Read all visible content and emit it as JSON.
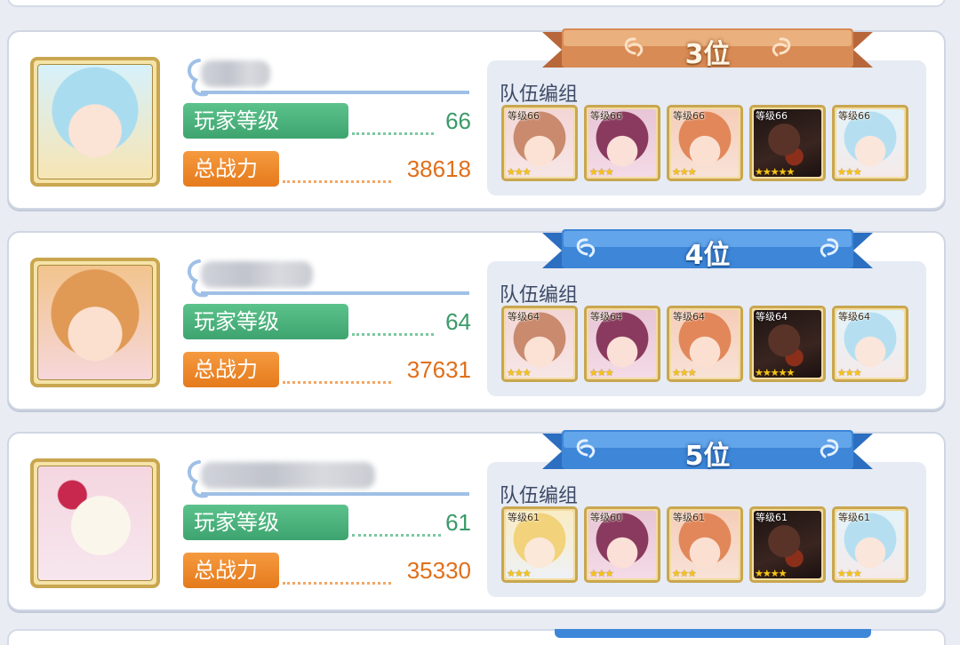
{
  "team_title": "队伍编组",
  "rows": [
    {
      "rank": "3位",
      "ribbon_style": "bronze",
      "player_level_label": "玩家等级",
      "player_level": "66",
      "total_power_label": "总战力",
      "total_power": "38618",
      "avatar": "blue-hair-girl-portrait",
      "team": [
        {
          "level": "等级66",
          "stars": "★★★",
          "art": "brown-hair-wink"
        },
        {
          "level": "等级66",
          "stars": "★★★",
          "art": "purple-hair-girl"
        },
        {
          "level": "等级66",
          "stars": "★★★",
          "art": "orange-hair-girl"
        },
        {
          "level": "等级66",
          "stars": "★★★★★",
          "art": "dark-rock-creature"
        },
        {
          "level": "等级66",
          "stars": "★★★",
          "art": "blue-hair-girl"
        }
      ]
    },
    {
      "rank": "4位",
      "ribbon_style": "blue",
      "player_level_label": "玩家等级",
      "player_level": "64",
      "total_power_label": "总战力",
      "total_power": "37631",
      "avatar": "orange-hair-girl-portrait",
      "team": [
        {
          "level": "等级64",
          "stars": "★★★",
          "art": "brown-hair-wink"
        },
        {
          "level": "等级64",
          "stars": "★★★",
          "art": "purple-hair-girl"
        },
        {
          "level": "等级64",
          "stars": "★★★",
          "art": "orange-hair-girl"
        },
        {
          "level": "等级64",
          "stars": "★★★★★",
          "art": "dark-rock-creature"
        },
        {
          "level": "等级64",
          "stars": "★★★",
          "art": "blue-hair-girl"
        }
      ]
    },
    {
      "rank": "5位",
      "ribbon_style": "blue",
      "player_level_label": "玩家等级",
      "player_level": "61",
      "total_power_label": "总战力",
      "total_power": "35330",
      "avatar": "alpaca-portrait",
      "team": [
        {
          "level": "等级61",
          "stars": "★★★",
          "art": "blonde-girl"
        },
        {
          "level": "等级60",
          "stars": "★★★",
          "art": "purple-hair-girl"
        },
        {
          "level": "等级61",
          "stars": "★★★",
          "art": "orange-hair-girl"
        },
        {
          "level": "等级61",
          "stars": "★★★★",
          "art": "dark-rock-creature"
        },
        {
          "level": "等级61",
          "stars": "★★★",
          "art": "blue-hair-girl"
        }
      ]
    }
  ],
  "colors": {
    "level_green": "#3ea46f",
    "power_orange": "#e57a1c",
    "ribbon_blue": "#3d86d8",
    "ribbon_bronze": "#c97a45",
    "frame_gold": "#c9a64f"
  }
}
